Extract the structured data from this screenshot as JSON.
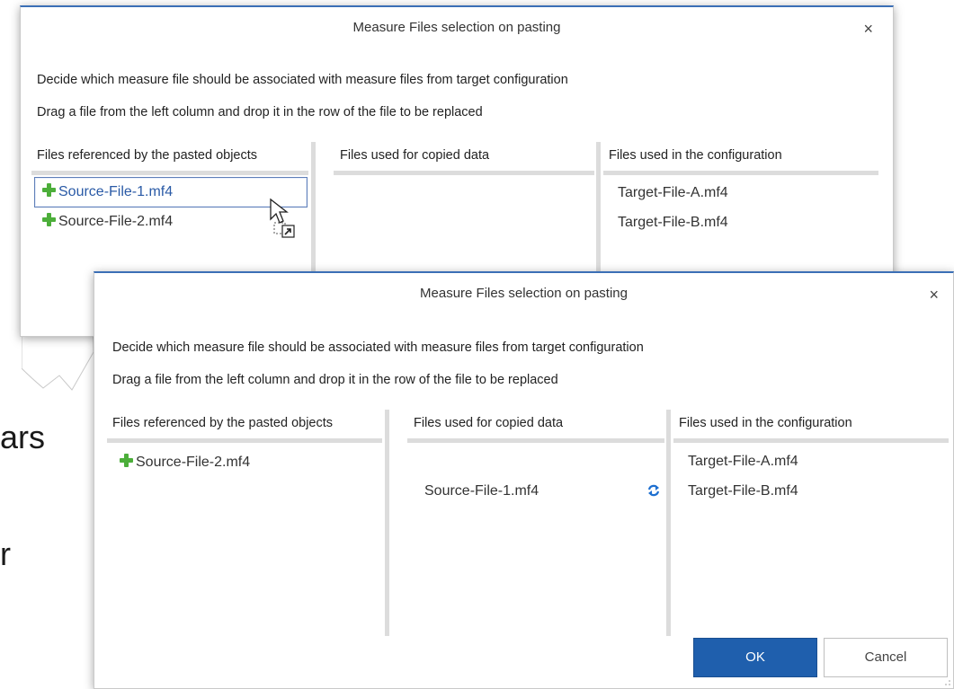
{
  "background": {
    "text_fragment_1": "ars",
    "text_fragment_2": "r"
  },
  "dialog_back": {
    "title": "Measure Files selection on pasting",
    "close_glyph": "×",
    "instruction_1": "Decide which measure file should be associated with measure files from target configuration",
    "instruction_2": "Drag a file from the left column and drop it in the row of the file to be replaced",
    "columns": {
      "referenced": "Files referenced by the pasted objects",
      "copied": "Files used for copied data",
      "configuration": "Files used in the configuration"
    },
    "referenced_files": [
      "Source-File-1.mf4",
      "Source-File-2.mf4"
    ],
    "configuration_files": [
      "Target-File-A.mf4",
      "Target-File-B.mf4"
    ]
  },
  "dialog_front": {
    "title": "Measure Files selection on pasting",
    "close_glyph": "×",
    "instruction_1": "Decide which measure file should be associated with measure files from target configuration",
    "instruction_2": "Drag a file from the left column and drop it in the row of the file to be replaced",
    "columns": {
      "referenced": "Files referenced by the pasted objects",
      "copied": "Files used for copied data",
      "configuration": "Files used in the configuration"
    },
    "referenced_files": [
      "Source-File-2.mf4"
    ],
    "copied_files": [
      "Source-File-1.mf4"
    ],
    "configuration_files": [
      "Target-File-A.mf4",
      "Target-File-B.mf4"
    ],
    "ok_label": "OK",
    "cancel_label": "Cancel"
  },
  "colors": {
    "ok_button": "#1f5fad",
    "selection_border": "#5f7fb8",
    "plus_icon": "#4cae3a",
    "swap_icon": "#1e6fd0"
  },
  "icons": [
    "plus-icon",
    "mouse-cursor-icon",
    "shortcut-link-icon",
    "swap-icon",
    "close-icon",
    "resize-grip-icon"
  ]
}
